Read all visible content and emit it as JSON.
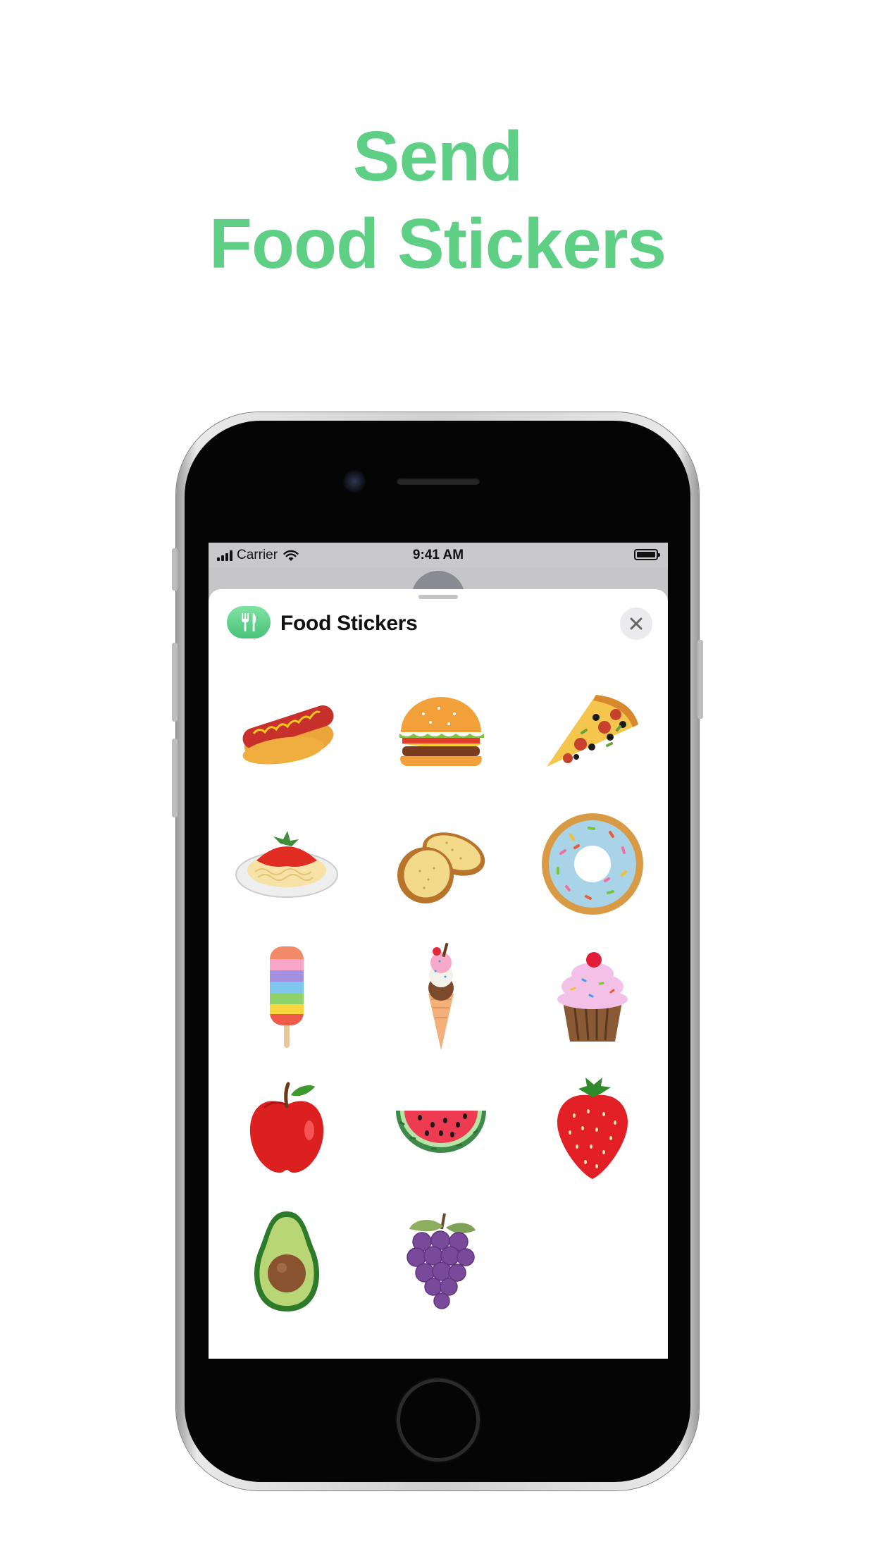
{
  "headline": {
    "line1": "Send",
    "line2": "Food Stickers"
  },
  "status_bar": {
    "carrier": "Carrier",
    "time": "9:41 AM"
  },
  "sticker_app": {
    "title": "Food Stickers",
    "icon": "fork-knife-icon",
    "close_icon": "close-icon"
  },
  "stickers": [
    {
      "name": "hot-dog"
    },
    {
      "name": "burger"
    },
    {
      "name": "pizza-slice"
    },
    {
      "name": "spaghetti"
    },
    {
      "name": "garlic-bread"
    },
    {
      "name": "donut"
    },
    {
      "name": "rainbow-popsicle"
    },
    {
      "name": "ice-cream-cone"
    },
    {
      "name": "cupcake"
    },
    {
      "name": "apple"
    },
    {
      "name": "watermelon"
    },
    {
      "name": "strawberry"
    },
    {
      "name": "avocado"
    },
    {
      "name": "grapes"
    }
  ],
  "colors": {
    "headline_green": "#5fcf86",
    "app_icon_green": "#48c27a"
  }
}
